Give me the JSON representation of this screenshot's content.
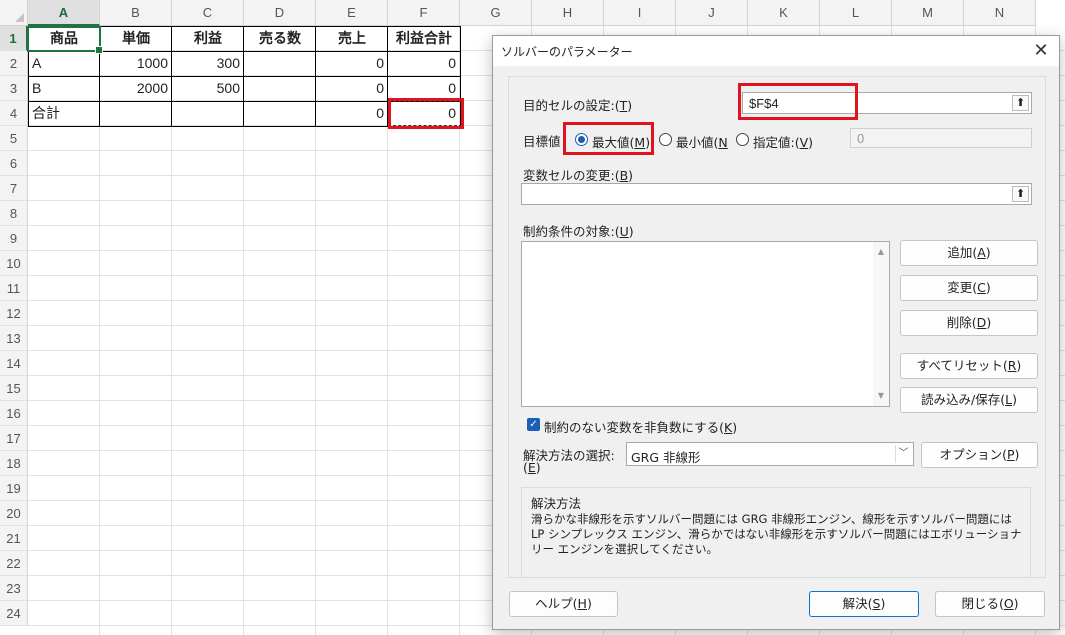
{
  "sheet": {
    "columns": [
      "A",
      "B",
      "C",
      "D",
      "E",
      "F",
      "G",
      "H",
      "I",
      "J",
      "K",
      "L",
      "M",
      "N"
    ],
    "rows": [
      "1",
      "2",
      "3",
      "4",
      "5",
      "6",
      "7",
      "8",
      "9",
      "10",
      "11",
      "12",
      "13",
      "14",
      "15",
      "16",
      "17",
      "18",
      "19",
      "20",
      "21",
      "22",
      "23",
      "24"
    ],
    "header_row": [
      "商品",
      "単価",
      "利益",
      "売る数",
      "売上",
      "利益合計"
    ],
    "data_rows": [
      [
        "A",
        "1000",
        "300",
        "",
        "0",
        "0"
      ],
      [
        "B",
        "2000",
        "500",
        "",
        "0",
        "0"
      ],
      [
        "合計",
        "",
        "",
        "",
        "0",
        "0"
      ]
    ],
    "colors": {
      "accent": "#217346",
      "highlight": "#e0141e"
    }
  },
  "dialog": {
    "title": "ソルバーのパラメーター",
    "close_icon": "close-icon",
    "objective_label": "目的セルの設定:(",
    "objective_key": "T",
    "objective_value": "$F$4",
    "target_label": "目標値",
    "radio_max": "最大値(",
    "radio_max_key": "M",
    "radio_min": "最小値(",
    "radio_min_key": "N",
    "radio_value": "指定値:(",
    "radio_value_key": "V",
    "value_of": "0",
    "variables_label": "変数セルの変更:(",
    "variables_key": "B",
    "variables_value": "",
    "constraints_label": "制約条件の対象:(",
    "constraints_key": "U",
    "btn_add": "追加(",
    "btn_add_key": "A",
    "btn_change": "変更(",
    "btn_change_key": "C",
    "btn_delete": "削除(",
    "btn_delete_key": "D",
    "btn_reset": "すべてリセット(",
    "btn_reset_key": "R",
    "btn_load": "読み込み/保存(",
    "btn_load_key": "L",
    "nonneg_label": "制約のない変数を非負数にする(",
    "nonneg_key": "K",
    "nonneg_checked": true,
    "method_label": "解決方法の選択:",
    "method_key": "E",
    "method_value": "GRG 非線形",
    "btn_options": "オプション(",
    "btn_options_key": "P",
    "desc_title": "解決方法",
    "desc_text": "滑らかな非線形を示すソルバー問題には GRG 非線形エンジン、線形を示すソルバー問題には LP シンプレックス エンジン、滑らかではない非線形を示すソルバー問題にはエボリューショナリー エンジンを選択してください。",
    "btn_help": "ヘルプ(",
    "btn_help_key": "H",
    "btn_solve": "解決(",
    "btn_solve_key": "S",
    "btn_close": "閉じる(",
    "btn_close_key": "O",
    "close_paren": ")"
  }
}
